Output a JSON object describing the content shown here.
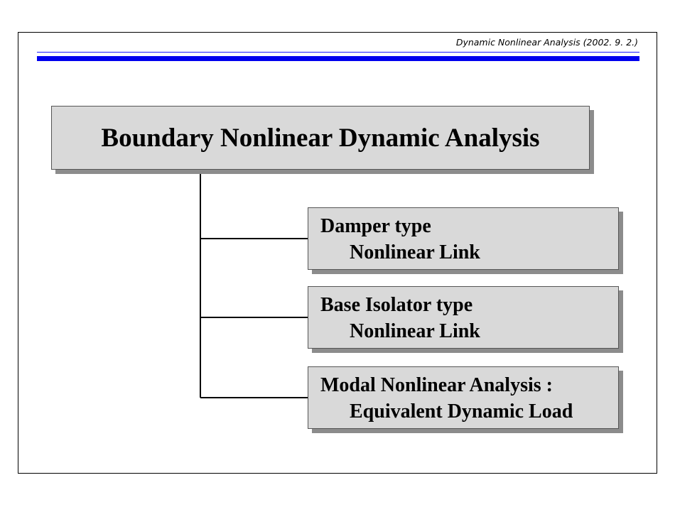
{
  "header": {
    "title": "Dynamic Nonlinear Analysis (2002. 9. 2.)"
  },
  "diagram": {
    "root": "Boundary Nonlinear Dynamic Analysis",
    "children": [
      {
        "title": "Damper type",
        "detail": "Nonlinear Link"
      },
      {
        "title": "Base Isolator type",
        "detail": "Nonlinear Link"
      },
      {
        "title": "Modal Nonlinear Analysis :",
        "detail": "Equivalent Dynamic Load"
      }
    ]
  },
  "colors": {
    "rule_blue": "#0000ee",
    "box_fill": "#d9d9d9",
    "box_shadow": "#8c8c8c"
  }
}
